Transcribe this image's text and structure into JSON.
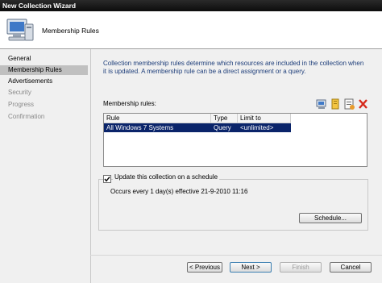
{
  "window": {
    "title": "New Collection Wizard"
  },
  "header": {
    "title": "Membership Rules",
    "icon": "computer-monitor-icon"
  },
  "nav": {
    "items": [
      {
        "label": "General",
        "state": "done"
      },
      {
        "label": "Membership Rules",
        "state": "active"
      },
      {
        "label": "Advertisements",
        "state": "done"
      },
      {
        "label": "Security",
        "state": "disabled"
      },
      {
        "label": "Progress",
        "state": "disabled"
      },
      {
        "label": "Confirmation",
        "state": "disabled"
      }
    ]
  },
  "main": {
    "description": "Collection membership rules determine which resources are included in the collection when it is updated. A membership rule can be a direct assignment or a query.",
    "rules_label": "Membership rules:",
    "toolbar": [
      "new-computer-icon",
      "new-query-icon",
      "properties-icon",
      "delete-icon"
    ],
    "table": {
      "columns": [
        "Rule",
        "Type",
        "Limit to"
      ],
      "rows": [
        {
          "rule": "All Windows 7 Systems",
          "type": "Query",
          "limit": "<unlimited>"
        }
      ]
    },
    "schedule": {
      "checkbox_label": "Update this collection on a schedule",
      "checked": true,
      "summary": "Occurs every 1 day(s) effective 21-9-2010 11:16",
      "button_label": "Schedule..."
    }
  },
  "footer": {
    "previous": "< Previous",
    "next": "Next >",
    "finish": "Finish",
    "cancel": "Cancel"
  },
  "colors": {
    "selection": "#0a246a",
    "description_text": "#1e3e7a",
    "delete": "#d62a1c"
  }
}
